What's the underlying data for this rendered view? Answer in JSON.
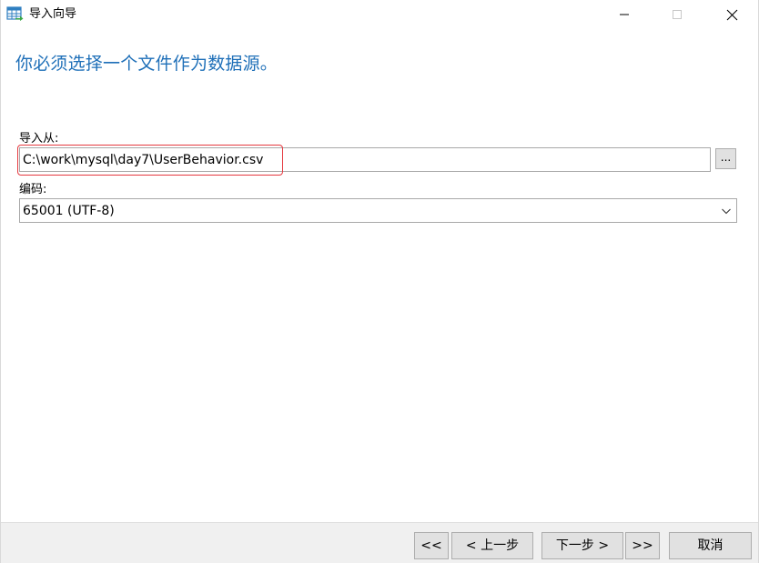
{
  "window": {
    "title": "导入向导"
  },
  "page": {
    "heading": "你必须选择一个文件作为数据源。"
  },
  "import_from": {
    "label": "导入从:",
    "value": "C:\\work\\mysql\\day7\\UserBehavior.csv",
    "browse_label": "..."
  },
  "encoding": {
    "label": "编码:",
    "selected": "65001 (UTF-8)"
  },
  "nav": {
    "first_label": "<<",
    "prev_label": "< 上一步",
    "next_label": "下一步 >",
    "last_label": ">>",
    "cancel_label": "取消"
  },
  "colors": {
    "heading": "#1e6fb8",
    "highlight": "#e5393f",
    "button_face": "#e1e1e1",
    "footer": "#f0f0f0"
  }
}
